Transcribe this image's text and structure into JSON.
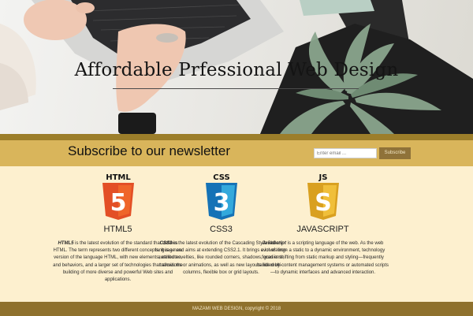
{
  "hero": {
    "title": "Affordable Prfessional Web Design"
  },
  "newsletter": {
    "title": "Subscribe to our newsletter",
    "email_placeholder": "Enter email ...",
    "subscribe_label": "Subscribe"
  },
  "features": [
    {
      "badge": "HTML",
      "numeral": "5",
      "title": "HTML5",
      "lead": "HTML5",
      "text": " is the latest evolution of the standard that defines HTML. The term represents two different concepts. It is a new version of the language HTML, with new elements, attributes, and behaviors, and a larger set of technologies that allows the building of more diverse and powerful Web sites and applications.",
      "color": "#e34f26"
    },
    {
      "badge": "CSS",
      "numeral": "3",
      "title": "CSS3",
      "lead": "CSS3",
      "text": " is the latest evolution of the Cascading Style Sheets language and aims at extending CSS2.1. It brings a lot of long-awaited novelties, like rounded corners, shadows, gradients, transitions or animations, as well as new layouts like multi-columns, flexible box or grid layouts.",
      "color": "#1572b6"
    },
    {
      "badge": "JS",
      "numeral": "S",
      "title": "JAVASCRIPT",
      "lead": "JavaScript",
      "text": " is a scripting language of the web. As the web evolves from a static to a dynamic environment, technology focus is shifting from static markup and styling—frequently handled by content management systems or automated scripts—to dynamic interfaces and advanced interaction.",
      "color": "#e0a526"
    }
  ],
  "footer": {
    "text": "MAZAMI WEB DESIGN, copyright © 2018"
  }
}
